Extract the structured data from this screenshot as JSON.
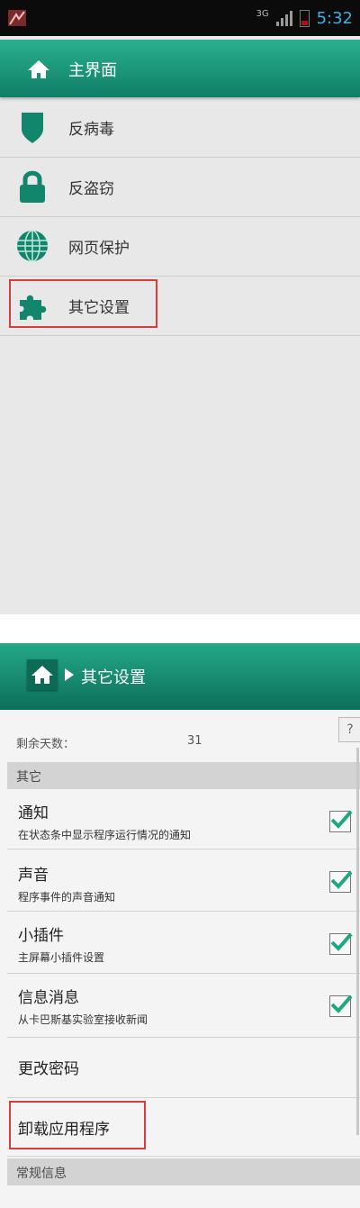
{
  "status_bar": {
    "network": "3G",
    "time": "5:32"
  },
  "screen1": {
    "header_title": "主界面",
    "menu": [
      {
        "label": "反病毒",
        "icon": "shield-icon"
      },
      {
        "label": "反盗窃",
        "icon": "lock-icon"
      },
      {
        "label": "网页保护",
        "icon": "globe-icon"
      },
      {
        "label": "其它设置",
        "icon": "puzzle-icon"
      }
    ]
  },
  "screen2": {
    "header_title": "其它设置",
    "help_label": "?",
    "remaining_days_label": "剩余天数：",
    "remaining_days_value": "31",
    "section_other": "其它",
    "settings": [
      {
        "title": "通知",
        "subtitle": "在状态条中显示程序运行情况的通知",
        "checked": true
      },
      {
        "title": "声音",
        "subtitle": "程序事件的声音通知",
        "checked": true
      },
      {
        "title": "小插件",
        "subtitle": "主屏幕小插件设置",
        "checked": true
      },
      {
        "title": "信息消息",
        "subtitle": "从卡巴斯基实验室接收新闻",
        "checked": true
      }
    ],
    "change_password": "更改密码",
    "uninstall": "卸载应用程序",
    "section_general": "常规信息"
  },
  "colors": {
    "accent": "#12866c",
    "highlight": "#d83c3c",
    "check": "#1fa882"
  }
}
